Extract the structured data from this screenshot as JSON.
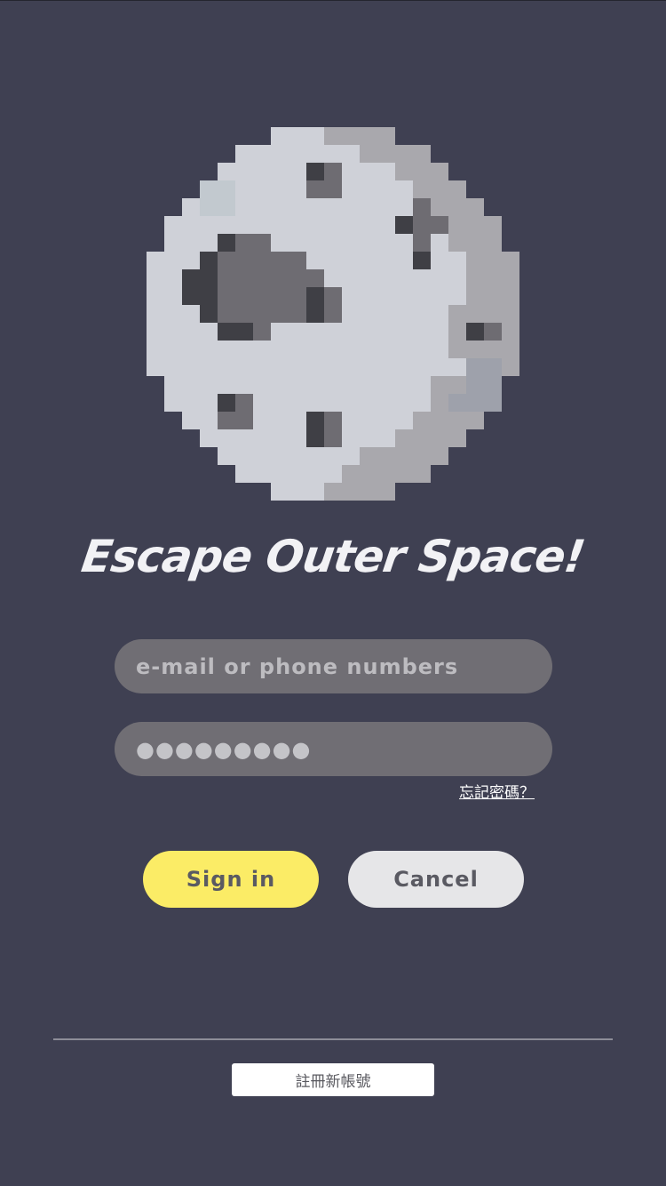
{
  "app": {
    "title": "Escape Outer Space!",
    "logo_icon": "pixel-moon-icon"
  },
  "login": {
    "email_placeholder": "e-mail or phone numbers",
    "email_value": "",
    "password_value": "●●●●●●●●●",
    "forgot_password": "忘記密碼？"
  },
  "actions": {
    "signin_label": "Sign in",
    "cancel_label": "Cancel",
    "register_label": "註冊新帳號"
  },
  "colors": {
    "background": "#3f4052",
    "field": "#706e74",
    "signin": "#fbec66",
    "cancel": "#e6e6e8",
    "moon_light": "#cfd1d8",
    "moon_shadow": "#a9a8ad",
    "crater": "#6e6c72",
    "crater_dark": "#3f3f45"
  }
}
